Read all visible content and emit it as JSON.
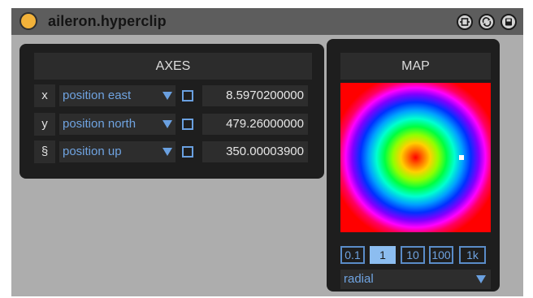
{
  "device": {
    "title": "aileron.hyperclip"
  },
  "titlebar_icons": [
    "hot-swap-icon",
    "refresh-icon",
    "save-icon"
  ],
  "axes": {
    "header": "AXES",
    "rows": [
      {
        "label": "x",
        "mode": "position east",
        "checked": false,
        "value": "8.5970200000"
      },
      {
        "label": "y",
        "mode": "position north",
        "checked": false,
        "value": "479.26000000"
      },
      {
        "label": "§",
        "mode": "position up",
        "checked": false,
        "value": "350.00003900"
      }
    ]
  },
  "map": {
    "header": "MAP",
    "zoom_options": [
      "0.1",
      "1",
      "10",
      "100",
      "1k"
    ],
    "zoom_selected": "1",
    "mode": "radial",
    "colors": {
      "accent": "#6fa3e0",
      "activator": "#f2b23a",
      "selected_zoom": "#8cbdf0"
    }
  }
}
